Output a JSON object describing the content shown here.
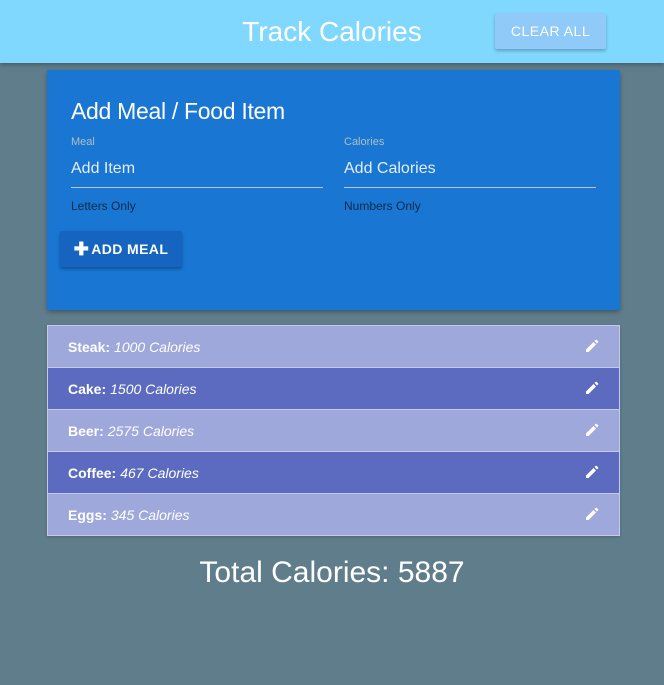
{
  "navbar": {
    "title": "Track Calories",
    "clear_label": "CLEAR ALL"
  },
  "form": {
    "title": "Add Meal / Food Item",
    "meal_label": "Meal",
    "meal_placeholder": "Add Item",
    "meal_helper": "Letters Only",
    "calories_label": "Calories",
    "calories_placeholder": "Add Calories",
    "calories_helper": "Numbers Only",
    "add_label": "ADD MEAL",
    "add_icon": "plus-icon"
  },
  "items": [
    {
      "name": "Steak:",
      "calories": "1000 Calories",
      "icon": "pencil-icon"
    },
    {
      "name": "Cake:",
      "calories": "1500 Calories",
      "icon": "pencil-icon"
    },
    {
      "name": "Beer:",
      "calories": "2575 Calories",
      "icon": "pencil-icon"
    },
    {
      "name": "Coffee:",
      "calories": "467 Calories",
      "icon": "pencil-icon"
    },
    {
      "name": "Eggs:",
      "calories": "345 Calories",
      "icon": "pencil-icon"
    }
  ],
  "total": "Total Calories: 5887",
  "colors": {
    "navbar": "#80d8ff",
    "background": "#607d8b",
    "card": "#1976d2",
    "row_light": "#9fa8da",
    "row_dark": "#5c6bc0"
  }
}
